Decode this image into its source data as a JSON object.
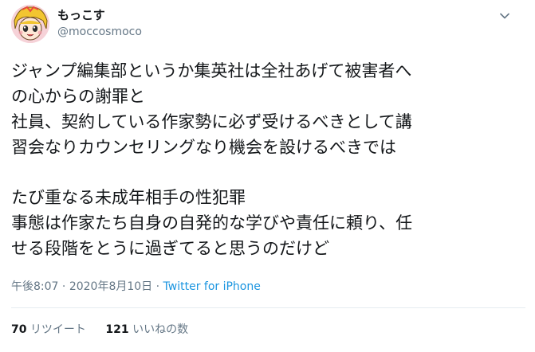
{
  "user": {
    "display_name": "もっこす",
    "handle": "@moccosmoco",
    "avatar_icon": "anime-avatar-icon"
  },
  "tweet": {
    "lines": [
      "ジャンプ編集部というか集英社は全社あげて被害者へ",
      "の心からの謝罪と",
      "社員、契約している作家勢に必ず受けるべきとして講",
      "習会なりカウンセリングなり機会を設けるべきでは",
      "",
      "たび重なる未成年相手の性犯罪",
      "事態は作家たち自身の自発的な学びや責任に頼り、任",
      "せる段階をとうに過ぎてると思うのだけど"
    ],
    "time": "午後8:07",
    "separator1": "·",
    "date": "2020年8月10日",
    "separator2": "·",
    "source": "Twitter for iPhone"
  },
  "stats": {
    "retweet_count": "70",
    "retweet_label": "リツイート",
    "like_count": "121",
    "like_label": "いいねの数"
  },
  "colors": {
    "text": "#14171a",
    "secondary": "#657786",
    "link": "#1b95e0",
    "divider": "#e6ecf0"
  }
}
